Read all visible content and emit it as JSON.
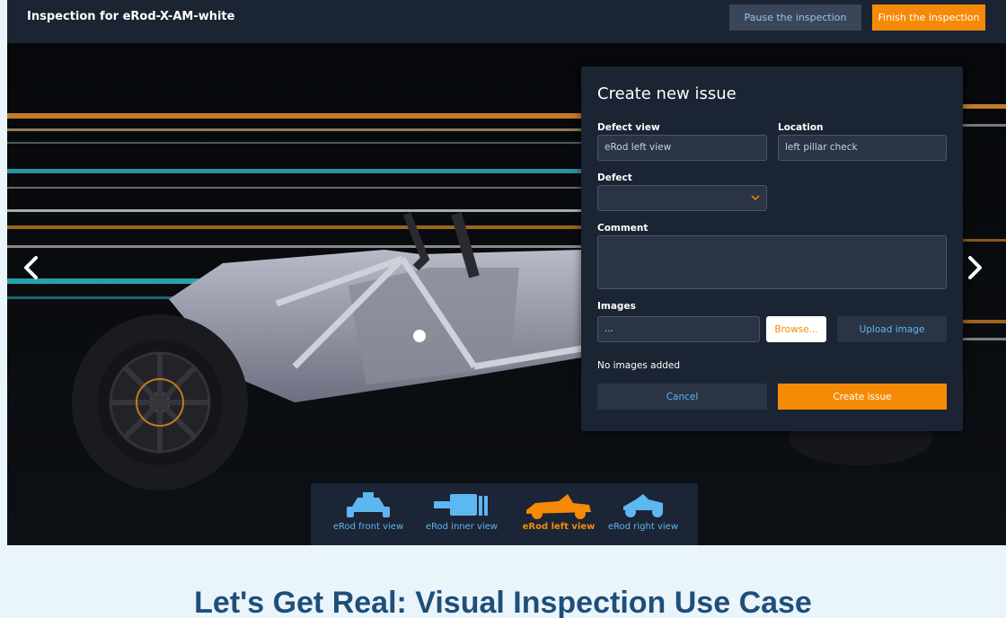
{
  "header": {
    "title": "Inspection for eRod-X-AM-white",
    "pause_label": "Pause the inspection",
    "finish_label": "Finish the inspection"
  },
  "modal": {
    "title": "Create new issue",
    "defect_view": {
      "label": "Defect view",
      "value": "eRod left view"
    },
    "location": {
      "label": "Location",
      "value": "left pillar check"
    },
    "defect": {
      "label": "Defect",
      "value": ""
    },
    "comment": {
      "label": "Comment",
      "value": ""
    },
    "images": {
      "label": "Images",
      "file_value": "...",
      "browse_label": "Browse...",
      "upload_label": "Upload image",
      "empty_text": "No images added"
    },
    "cancel_label": "Cancel",
    "create_label": "Create issue"
  },
  "views": [
    {
      "label": "eRod front view",
      "icon": "car-front-icon",
      "active": false
    },
    {
      "label": "eRod inner view",
      "icon": "car-inner-icon",
      "active": false
    },
    {
      "label": "eRod left view",
      "icon": "car-left-icon",
      "active": true
    },
    {
      "label": "eRod right view",
      "icon": "car-right-icon",
      "active": false
    }
  ],
  "caption": "Let's Get Real: Visual Inspection Use Case",
  "colors": {
    "accent": "#f58a07",
    "link": "#5db7f0",
    "panel": "#1b2433"
  }
}
